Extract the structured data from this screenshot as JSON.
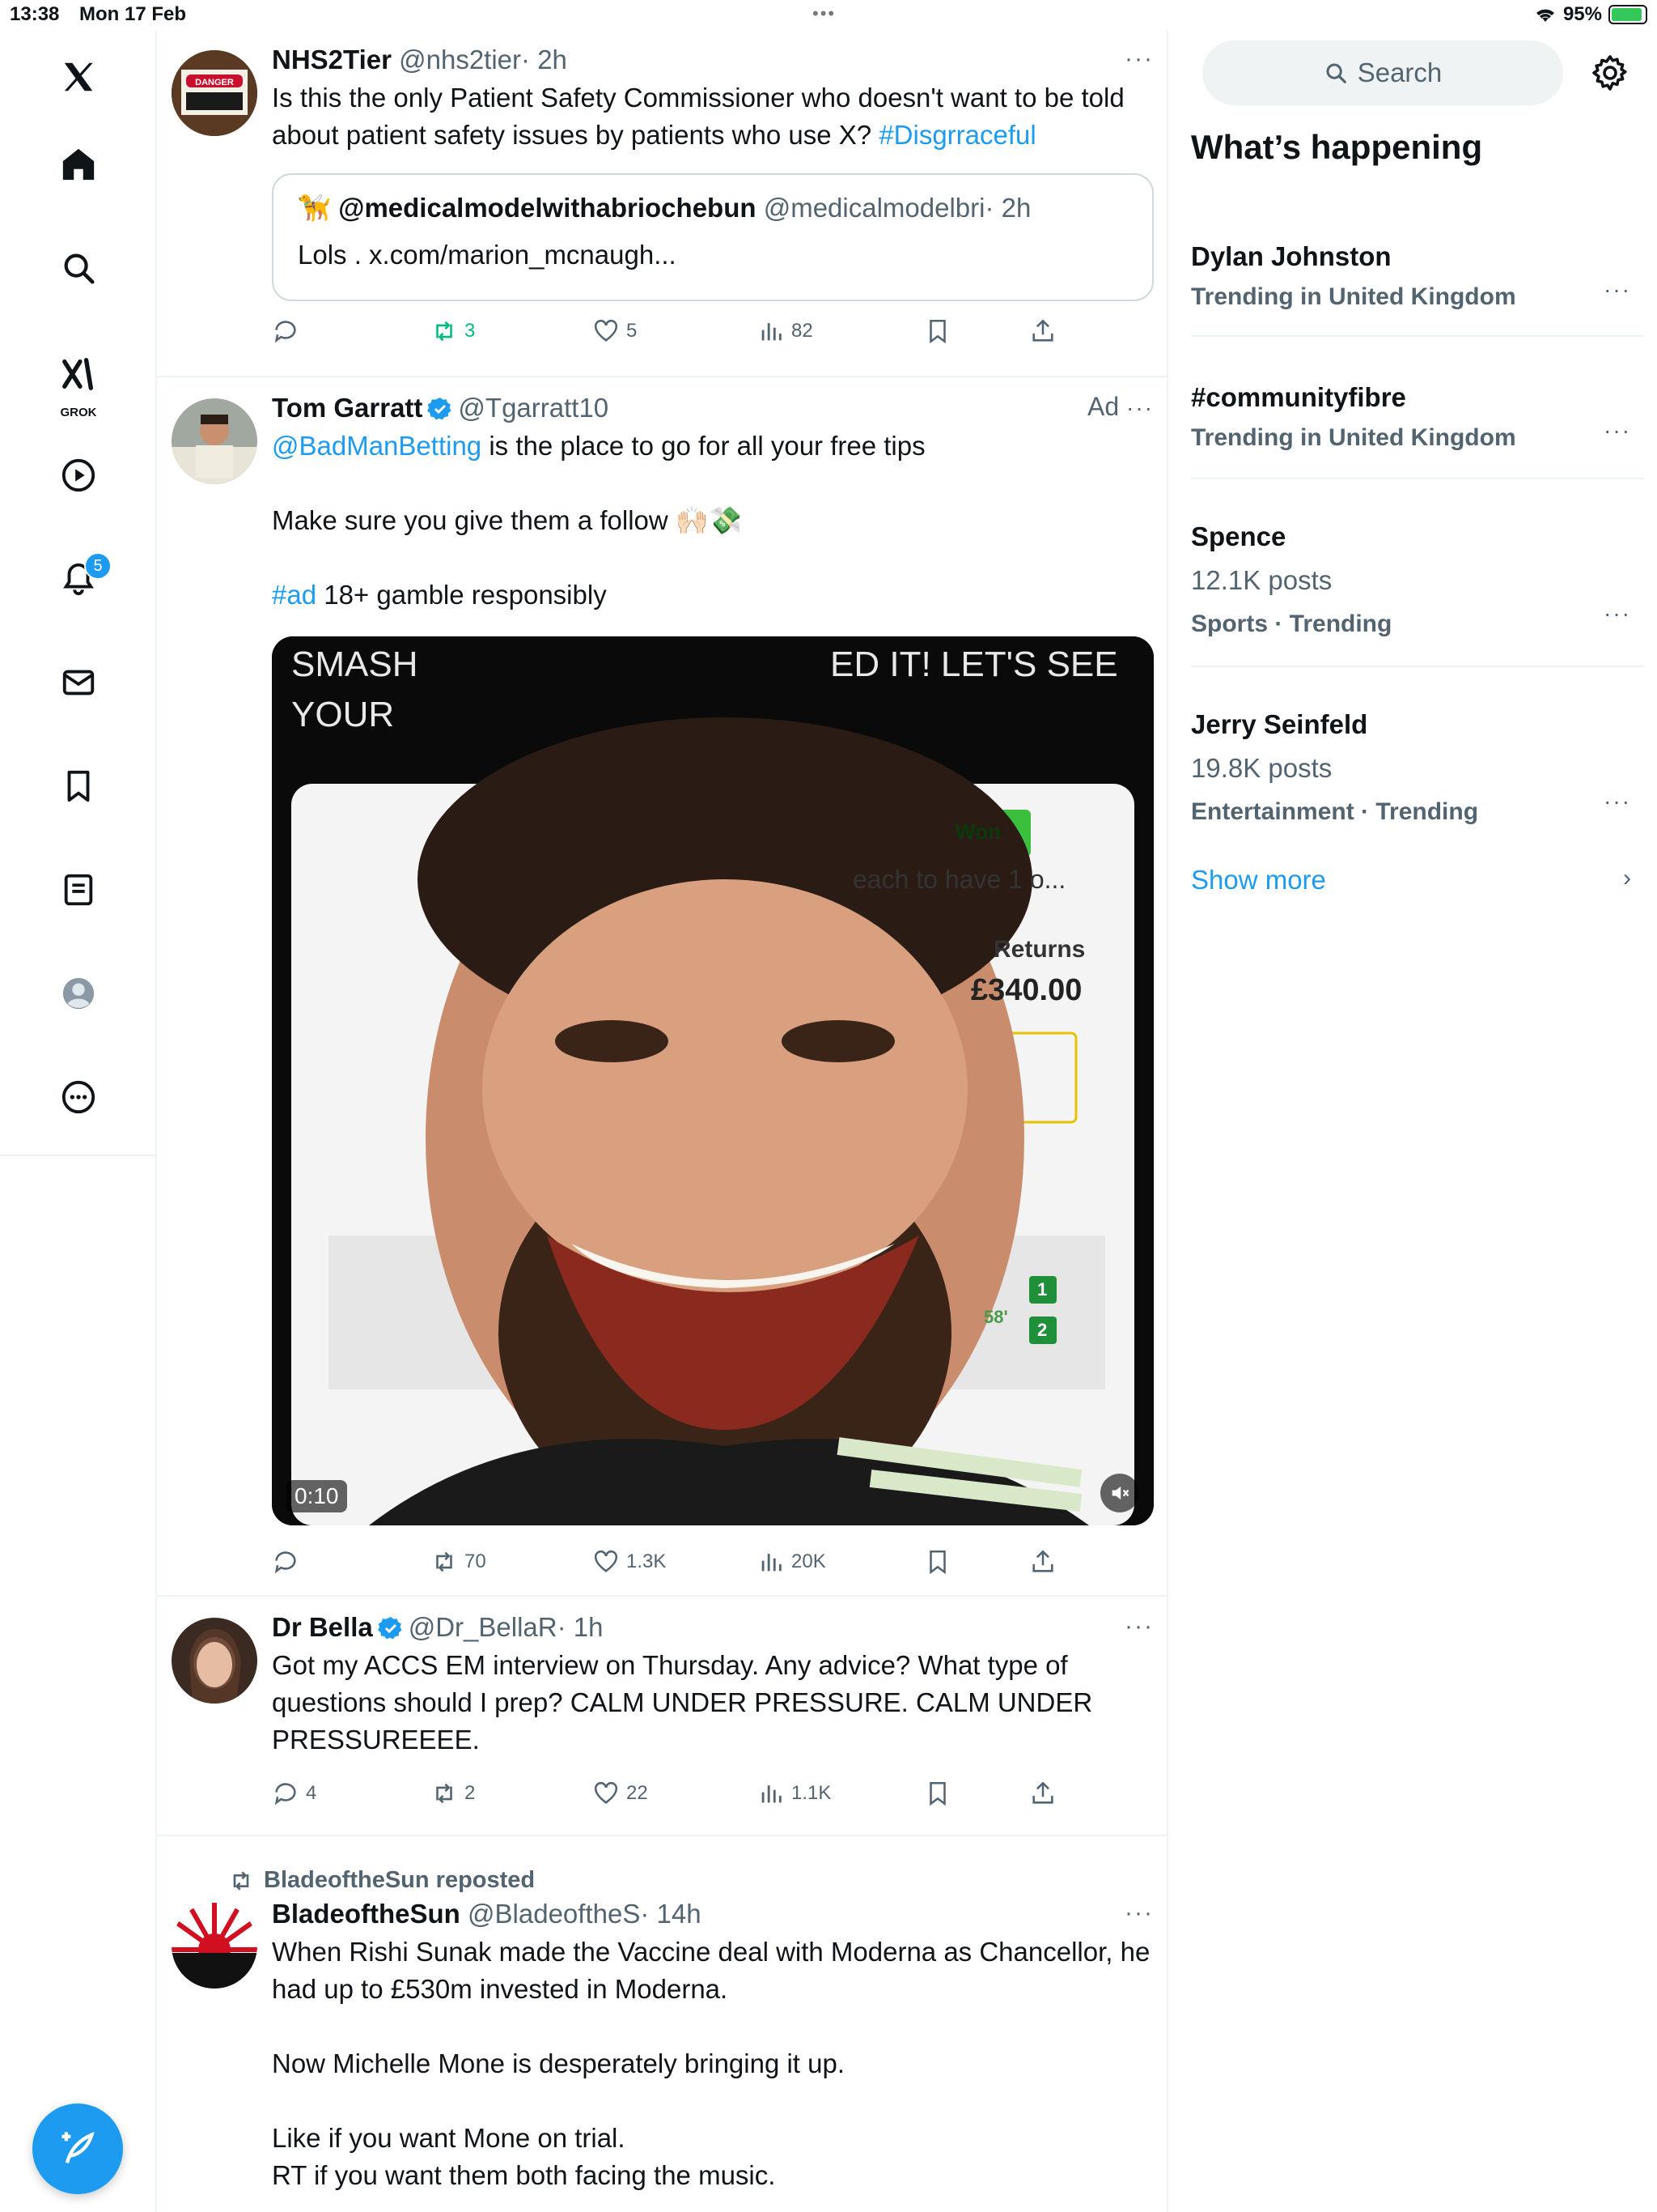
{
  "status_bar": {
    "time": "13:38",
    "date": "Mon 17 Feb",
    "battery": "95%",
    "battery_level": 0.95
  },
  "nav": {
    "items": [
      {
        "name": "x-logo-icon"
      },
      {
        "name": "home-icon"
      },
      {
        "name": "explore-icon"
      },
      {
        "name": "grok-icon",
        "label": "GROK"
      },
      {
        "name": "video-icon"
      },
      {
        "name": "notifications-icon",
        "badge": "5"
      },
      {
        "name": "messages-icon"
      },
      {
        "name": "bookmarks-icon"
      },
      {
        "name": "lists-icon"
      },
      {
        "name": "profile-icon"
      },
      {
        "name": "more-icon"
      }
    ],
    "compose_icon": "compose-icon"
  },
  "tweets": [
    {
      "name": "NHS2Tier",
      "handle": "@nhs2tier",
      "time": "· 2h",
      "text_before": "Is this the only Patient Safety Commissioner who doesn't want to be told about patient safety issues by patients who use X? ",
      "hashtag": "#Disgrraceful",
      "avatar_text": "DANGER",
      "quote": {
        "name": "@medicalmodelwithabriochebun",
        "handle": "@medicalmodelbri",
        "time": "· 2h",
        "text": "Lols . x.com/marion_mcnaugh..."
      },
      "stats": {
        "replies": "",
        "reposts": "3",
        "likes": "5",
        "views": "82"
      }
    },
    {
      "name": "Tom Garratt",
      "handle": "@Tgarratt10",
      "ad_label": "Ad",
      "mention": "@BadManBetting",
      "line1_rest": " is the place to go for all your free tips",
      "line2": "Make sure you give them a follow 🙌🏻💸",
      "ad_tag": "#ad",
      "line3_rest": " 18+ gamble responsibly",
      "video": {
        "overlay_left": "SMASH",
        "overlay_left2": "YOUR",
        "overlay_right": "ED IT! LET'S SEE",
        "won_label": "Won",
        "bet_text": "each to have 1 o...",
        "returns_label": "Returns",
        "returns_value": "£340.00",
        "minute": "58'",
        "score1": "1",
        "score2": "2",
        "duration": "0:10"
      },
      "stats": {
        "replies": "",
        "reposts": "70",
        "likes": "1.3K",
        "views": "20K"
      }
    },
    {
      "name": "Dr Bella",
      "handle": "@Dr_BellaR",
      "time": "· 1h",
      "text": "Got my ACCS EM interview on Thursday. Any advice? What type of questions should I prep? CALM UNDER PRESSURE. CALM UNDER PRESSUREEEE.",
      "stats": {
        "replies": "4",
        "reposts": "2",
        "likes": "22",
        "views": "1.1K"
      }
    },
    {
      "reposted_by": "BladeoftheSun reposted",
      "name": "BladeoftheSun",
      "handle": "@BladeoftheS",
      "time": "· 14h",
      "para1": "When Rishi Sunak made the Vaccine deal with Moderna as Chancellor, he had up to £530m invested in Moderna.",
      "para2": "Now Michelle Mone is desperately bringing it up.",
      "para3a": "Like if you want Mone on trial.",
      "para3b": "RT if you want them both facing the music."
    }
  ],
  "sidebar": {
    "search_placeholder": "Search",
    "title": "What’s happening",
    "trends": [
      {
        "name": "Dylan Johnston",
        "meta": "Trending in United Kingdom",
        "count": ""
      },
      {
        "name": "#communityfibre",
        "meta": "Trending in United Kingdom",
        "count": ""
      },
      {
        "name": "Spence",
        "meta": "Sports · Trending",
        "count": "12.1K posts"
      },
      {
        "name": "Jerry Seinfeld",
        "meta": "Entertainment · Trending",
        "count": "19.8K posts"
      }
    ],
    "show_more": "Show more"
  },
  "colors": {
    "accent": "#1d9bf0",
    "text": "#0f1419",
    "secondary": "#536471",
    "repost_active": "#00ba7c",
    "divider": "#eff3f4"
  }
}
